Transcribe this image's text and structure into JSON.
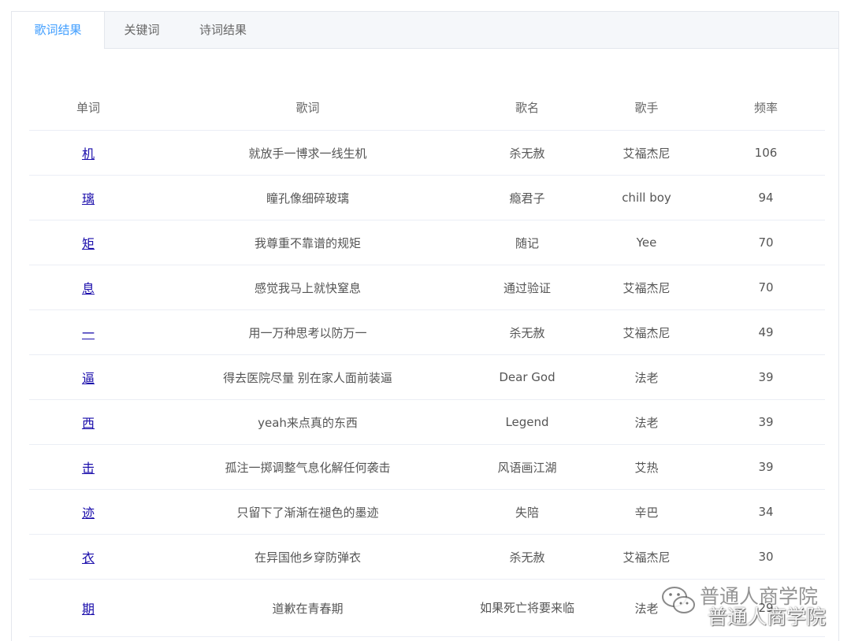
{
  "tabs": [
    {
      "label": "歌词结果",
      "active": true
    },
    {
      "label": "关键词",
      "active": false
    },
    {
      "label": "诗词结果",
      "active": false
    }
  ],
  "table": {
    "headers": [
      "单词",
      "歌词",
      "歌名",
      "歌手",
      "频率"
    ],
    "rows": [
      {
        "word": "机",
        "lyric": "就放手一博求一线生机",
        "song": "杀无赦",
        "singer": "艾福杰尼",
        "freq": "106"
      },
      {
        "word": "璃",
        "lyric": "瞳孔像细碎玻璃",
        "song": "瘾君子",
        "singer": "chill boy",
        "freq": "94"
      },
      {
        "word": "矩",
        "lyric": "我尊重不靠谱的规矩",
        "song": "随记",
        "singer": "Yee",
        "freq": "70"
      },
      {
        "word": "息",
        "lyric": "感觉我马上就快窒息",
        "song": "通过验证",
        "singer": "艾福杰尼",
        "freq": "70"
      },
      {
        "word": "一",
        "lyric": "用一万种思考以防万一",
        "song": "杀无赦",
        "singer": "艾福杰尼",
        "freq": "49"
      },
      {
        "word": "逼",
        "lyric": "得去医院尽量 别在家人面前装逼",
        "song": "Dear God",
        "singer": "法老",
        "freq": "39"
      },
      {
        "word": "西",
        "lyric": "yeah来点真的东西",
        "song": "Legend",
        "singer": "法老",
        "freq": "39"
      },
      {
        "word": "击",
        "lyric": "孤注一掷调整气息化解任何袭击",
        "song": "风语画江湖",
        "singer": "艾热",
        "freq": "39"
      },
      {
        "word": "迹",
        "lyric": "只留下了渐渐在褪色的墨迹",
        "song": "失陪",
        "singer": "辛巴",
        "freq": "34"
      },
      {
        "word": "衣",
        "lyric": "在异国他乡穿防弹衣",
        "song": "杀无赦",
        "singer": "艾福杰尼",
        "freq": "30"
      },
      {
        "word": "期",
        "lyric": "道歉在青春期",
        "song": "如果死亡将要来临",
        "singer": "法老",
        "freq": "29"
      }
    ]
  },
  "watermark": {
    "line1": "普通人商学院",
    "line2": "普通人商学院",
    "icon": "wechat-icon"
  },
  "colors": {
    "active_tab": "#409eff",
    "link": "#1a0dab",
    "border": "#ebeef5"
  }
}
